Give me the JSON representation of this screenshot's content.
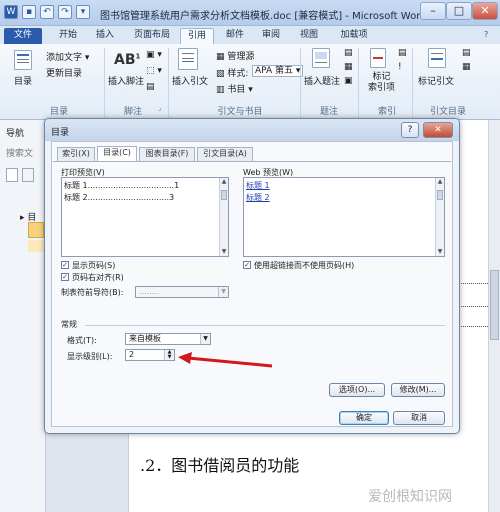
{
  "window": {
    "title": "图书馆管理系统用户需求分析文档模板.doc [兼容模式] - Microsoft Word",
    "min_symbol": "–",
    "max_symbol": "□",
    "close_symbol": "✕"
  },
  "menu": {
    "tabs": [
      "文件",
      "开始",
      "插入",
      "页面布局",
      "引用",
      "邮件",
      "审阅",
      "视图",
      "加载项"
    ]
  },
  "ribbon": {
    "groups": [
      {
        "label": "目录"
      },
      {
        "label": "脚注"
      },
      {
        "label": "引文与书目"
      },
      {
        "label": "题注"
      },
      {
        "label": "索引"
      },
      {
        "label": "引文目录"
      }
    ],
    "toc_button": "目录",
    "add_text": "添加文字 ▾",
    "update_toc": "更新目录",
    "insert_footnote": "插入脚注",
    "ab_glyph": "AB",
    "ab_sup": "1",
    "insert_citation": "插入引文",
    "manage_sources": "管理源",
    "style_label": "样式:",
    "style_value": "APA 第五 ▾",
    "bibliography": "书目 ▾",
    "insert_caption": "插入题注",
    "mark_entry": "标记\n索引项",
    "mark_citation": "标记引文"
  },
  "nav": {
    "title": "导航",
    "search": "搜索文",
    "tree_item": "目"
  },
  "dialog": {
    "title": "目录",
    "help": "?",
    "close": "✕",
    "tabs": [
      "索引(X)",
      "目录(C)",
      "图表目录(F)",
      "引文目录(A)"
    ],
    "print_preview_label": "打印预览(V)",
    "print_preview_lines": [
      {
        "text": "标题 1",
        "dots": "..................................",
        "page": "1"
      },
      {
        "text": "标题 2",
        "dots": "................................",
        "page": "3"
      }
    ],
    "web_preview_label": "Web 预览(W)",
    "web_preview_links": [
      "标题 1",
      "标题 2"
    ],
    "show_page_numbers": {
      "label": "显示页码(S)",
      "checked": true
    },
    "right_align": {
      "label": "页码右对齐(R)",
      "checked": true
    },
    "tab_leader_label": "制表符前导符(B):",
    "tab_leader_value": "........",
    "use_hyperlinks": {
      "label": "使用超链接而不使用页码(H)",
      "checked": true
    },
    "general_label": "常规",
    "format_label": "格式(T):",
    "format_value": "来自模板",
    "levels_label": "显示级别(L):",
    "levels_value": "2",
    "options_button": "选项(O)...",
    "modify_button": "修改(M)...",
    "ok_button": "确定",
    "cancel_button": "取消"
  },
  "document": {
    "heading": ".2．图书借阅员的功能"
  },
  "watermark": "爱创根知识网",
  "colors": {
    "accent": "#2b5cac",
    "arrow": "#d0191a",
    "link": "#1f3fb0"
  }
}
